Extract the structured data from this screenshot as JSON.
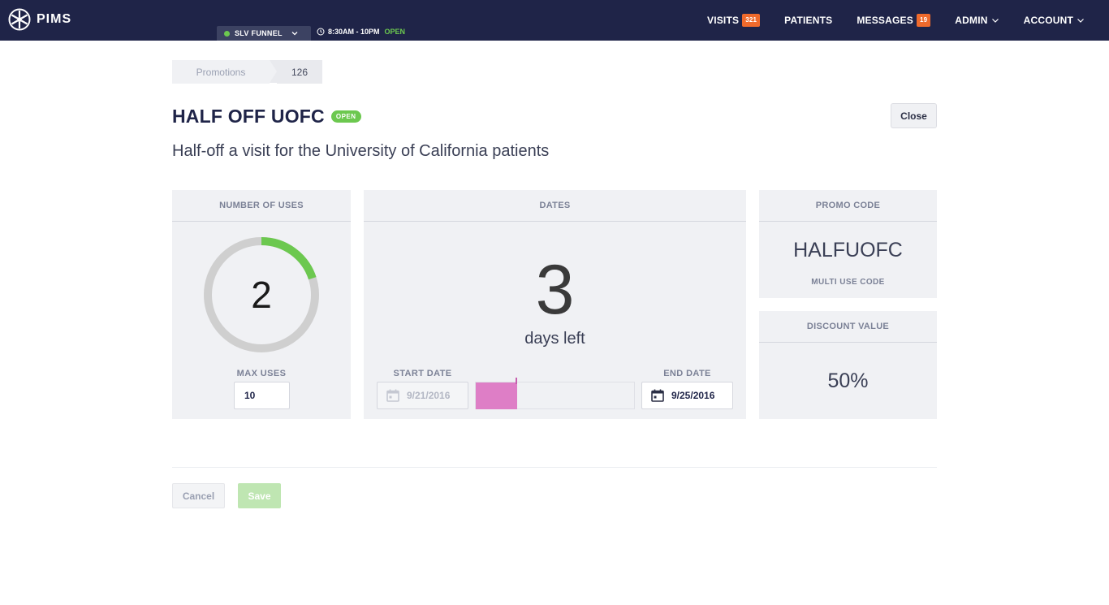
{
  "app": {
    "name": "PIMS"
  },
  "topbar": {
    "funnel_label": "SLV FUNNEL",
    "hours_label": "8:30AM - 10PM",
    "hours_status": "OPEN",
    "nav": {
      "visits": {
        "label": "VISITS",
        "badge": "321"
      },
      "patients": {
        "label": "PATIENTS"
      },
      "messages": {
        "label": "MESSAGES",
        "badge": "19"
      },
      "admin": {
        "label": "ADMIN"
      },
      "account": {
        "label": "ACCOUNT"
      }
    }
  },
  "breadcrumb": {
    "parent": "Promotions",
    "current": "126"
  },
  "promotion": {
    "title": "HALF OFF UOFC",
    "status": "OPEN",
    "description": "Half-off a visit for the University of California patients",
    "close_label": "Close"
  },
  "uses": {
    "header": "NUMBER OF USES",
    "count": "2",
    "max_label": "MAX USES",
    "max_value": "10",
    "fraction_used": 0.2
  },
  "dates": {
    "header": "DATES",
    "days_left": "3",
    "days_left_label": "days left",
    "start_label": "START DATE",
    "start_value": "9/21/2016",
    "end_label": "END DATE",
    "end_value": "9/25/2016",
    "elapsed_fraction": 0.26
  },
  "promo_code": {
    "header": "PROMO CODE",
    "code": "HALFUOFC",
    "type": "MULTI USE CODE"
  },
  "discount": {
    "header": "DISCOUNT VALUE",
    "value": "50%"
  },
  "actions": {
    "cancel_label": "Cancel",
    "save_label": "Save"
  },
  "colors": {
    "navbar": "#1f2448",
    "accent_green": "#6cc84f",
    "badge_orange": "#ef6a2c",
    "timeline_pink": "#de7ec6",
    "donut_track": "#cfcfcf"
  },
  "icons": {
    "logo": "pims-logo-icon",
    "funnel_status": "status-dot-icon",
    "dropdown": "chevron-down-icon",
    "clock": "clock-icon",
    "calendar": "calendar-icon"
  }
}
